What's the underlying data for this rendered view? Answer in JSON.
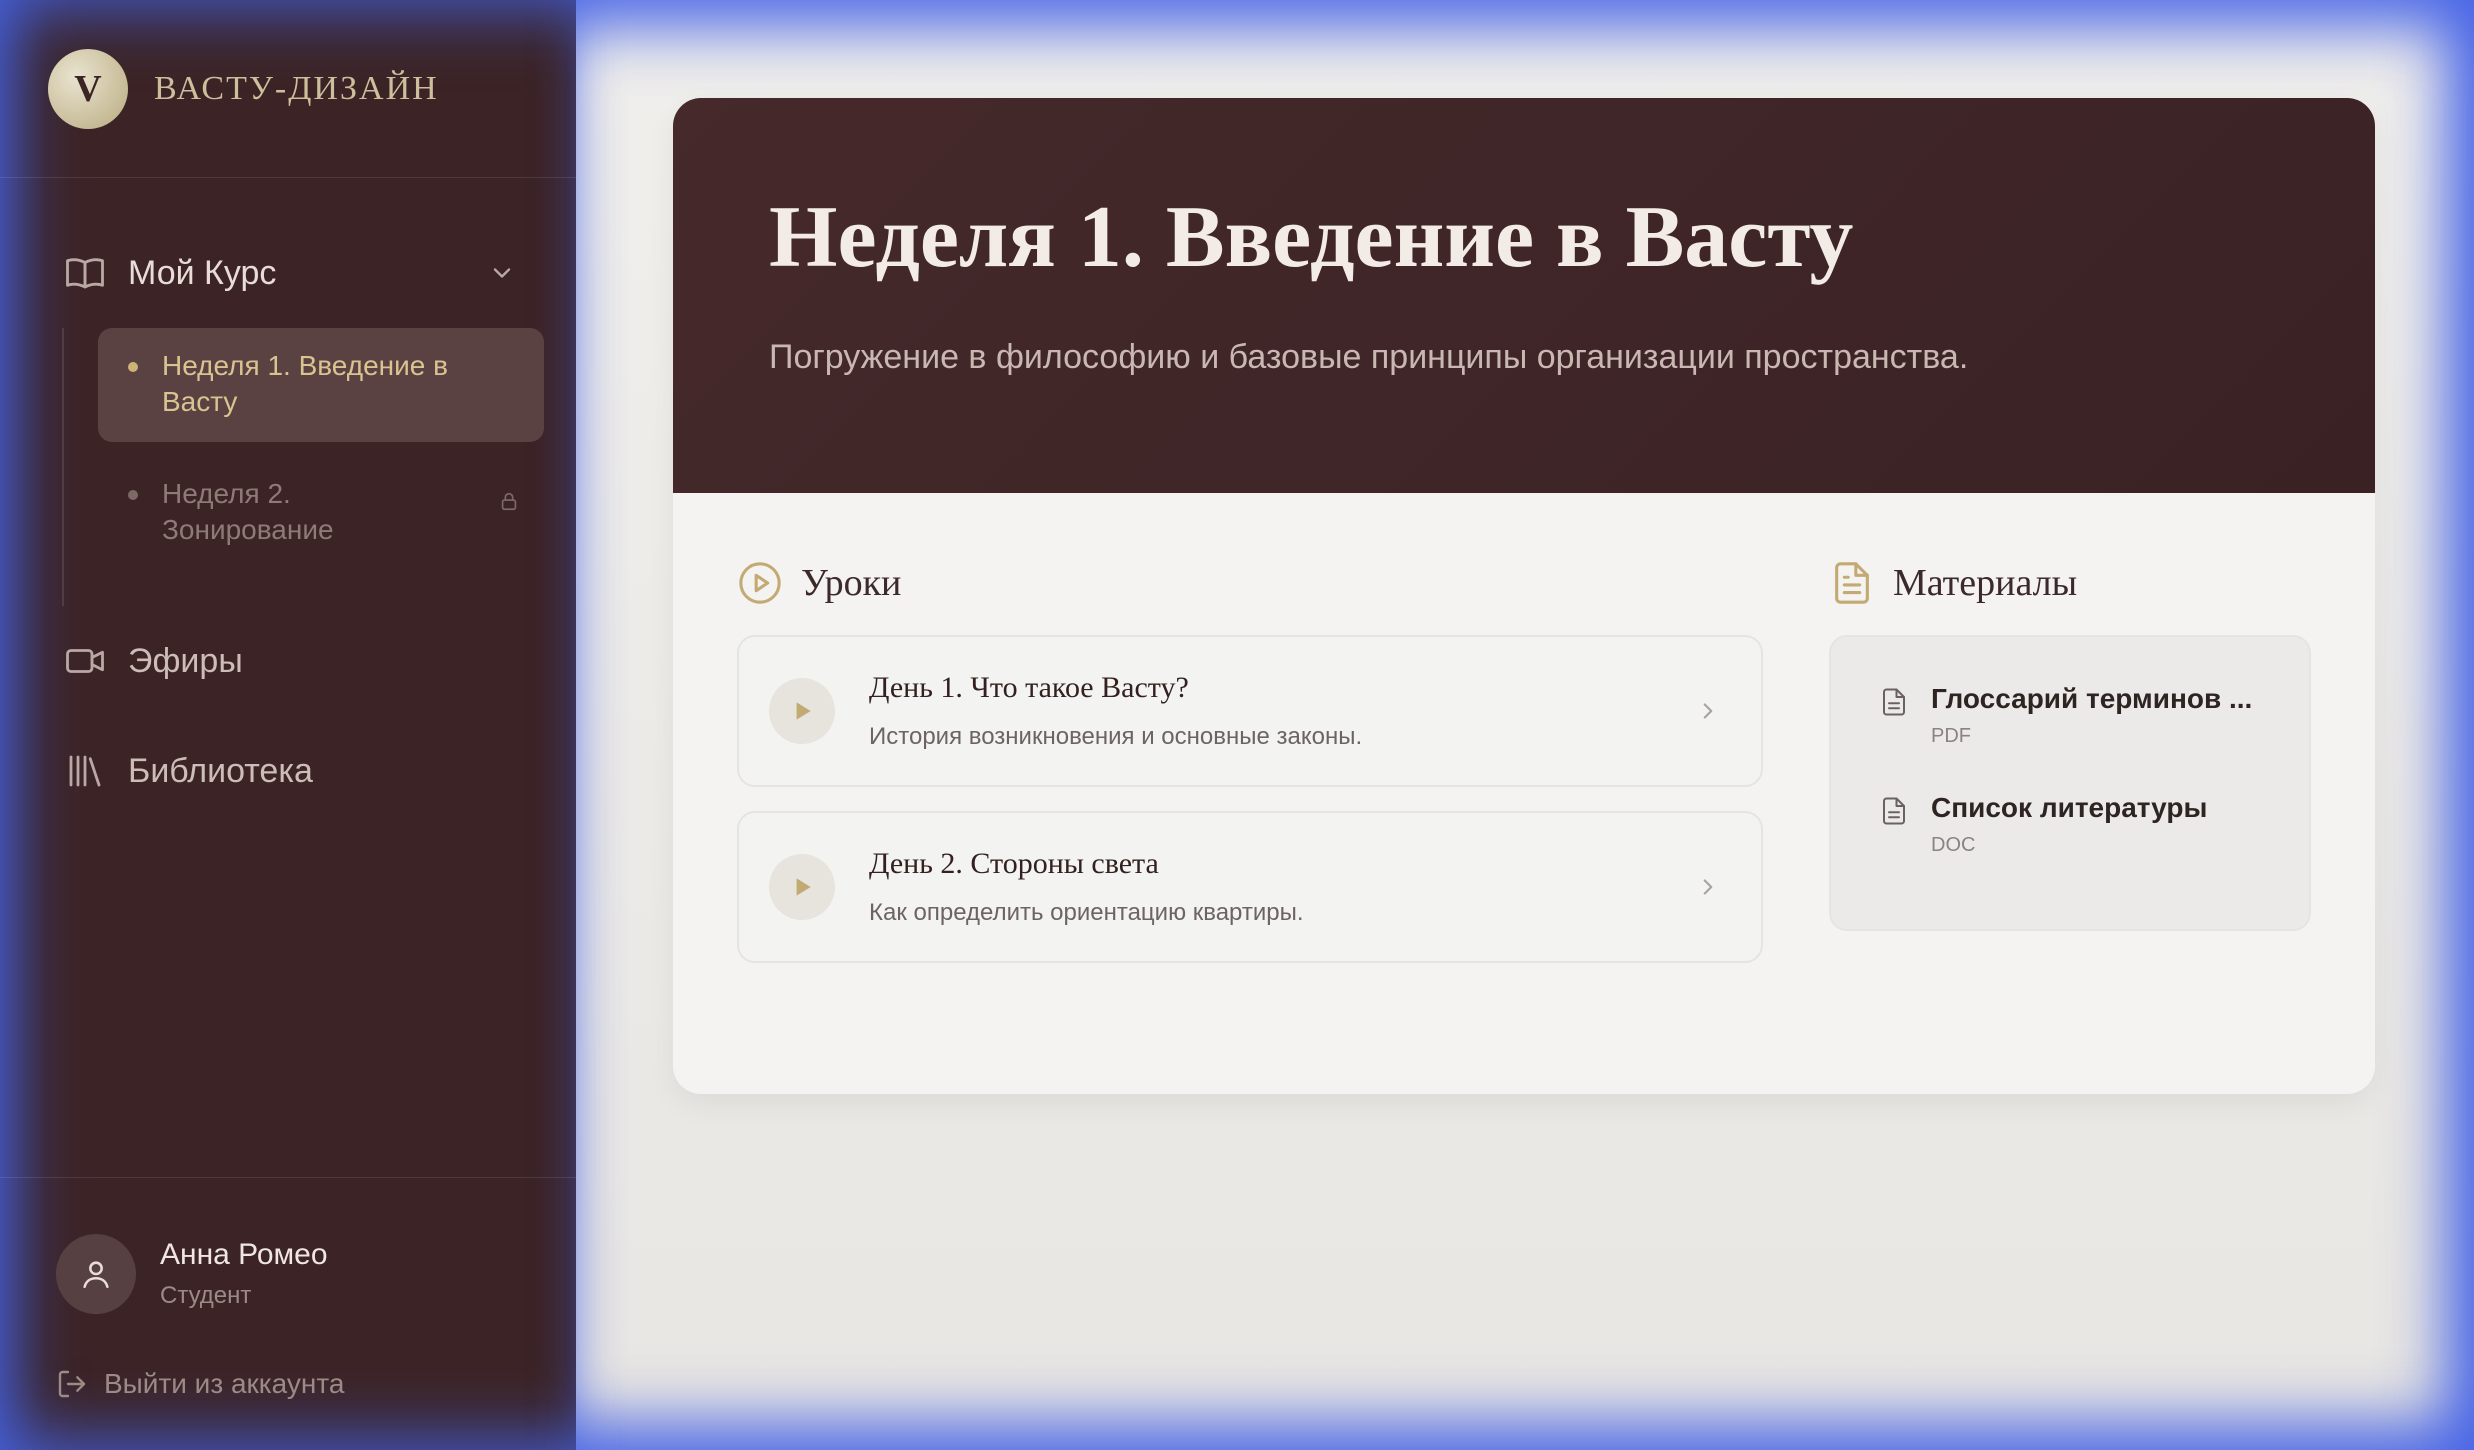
{
  "brand": {
    "logo_letter": "V",
    "name": "ВАСТУ-ДИЗАЙН"
  },
  "nav": {
    "course": {
      "label": "Мой Курс",
      "icon": "book-icon"
    },
    "weeks": [
      {
        "label": "Неделя 1. Введение в Васту",
        "active": true
      },
      {
        "label": "Неделя 2. Зонирование",
        "locked": true
      }
    ],
    "broadcasts": {
      "label": "Эфиры",
      "icon": "video-icon"
    },
    "library": {
      "label": "Библиотека",
      "icon": "library-icon"
    }
  },
  "user": {
    "name": "Анна Ромео",
    "role": "Студент"
  },
  "logout": {
    "label": "Выйти из аккаунта"
  },
  "hero": {
    "title": "Неделя 1. Введение в Васту",
    "subtitle": "Погружение в философию и базовые принципы организации пространства."
  },
  "lessons": {
    "heading": "Уроки",
    "items": [
      {
        "title": "День 1. Что такое Васту?",
        "desc": "История возникновения и основные законы."
      },
      {
        "title": "День 2. Стороны света",
        "desc": "Как определить ориентацию квартиры."
      }
    ]
  },
  "materials": {
    "heading": "Материалы",
    "items": [
      {
        "name": "Глоссарий терминов ...",
        "type": "PDF"
      },
      {
        "name": "Список литературы",
        "type": "DOC"
      }
    ]
  },
  "colors": {
    "sidebar_bg": "#3c2426",
    "accent_gold": "#c2aa72",
    "hero_bg": "#45292b",
    "frame_blue": "#4f72e4"
  }
}
